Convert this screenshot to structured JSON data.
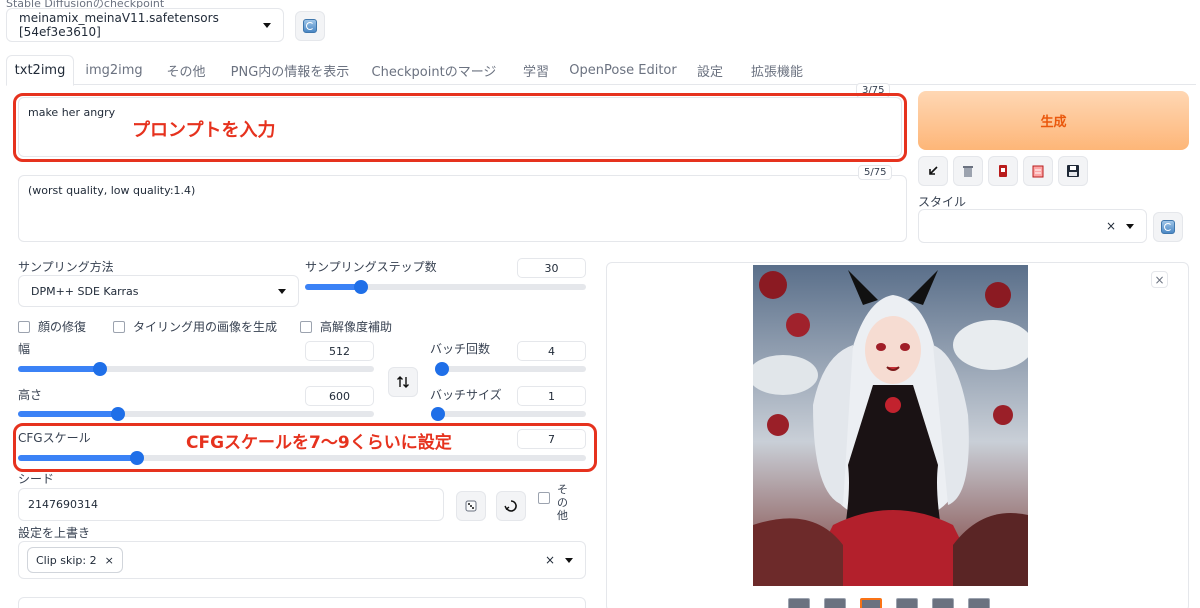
{
  "top_cut_label": "Stable Diffusionのcheckpoint",
  "checkpoint": {
    "value": "meinamix_meinaV11.safetensors [54ef3e3610]"
  },
  "tabs": [
    {
      "label": "txt2img"
    },
    {
      "label": "img2img"
    },
    {
      "label": "その他"
    },
    {
      "label": "PNG内の情報を表示"
    },
    {
      "label": "Checkpointのマージ"
    },
    {
      "label": "学習"
    },
    {
      "label": "OpenPose Editor"
    },
    {
      "label": "設定"
    },
    {
      "label": "拡張機能"
    }
  ],
  "prompt": {
    "value": "make her angry",
    "counter": "3/75"
  },
  "negative_prompt": {
    "value": "(worst quality, low quality:1.4)",
    "counter": "5/75"
  },
  "annotations": {
    "prompt": "プロンプトを入力",
    "cfg": "CFGスケールを7〜9くらいに設定"
  },
  "generate_label": "生成",
  "style": {
    "label": "スタイル"
  },
  "sampling": {
    "method_label": "サンプリング方法",
    "method_value": "DPM++ SDE Karras",
    "steps_label": "サンプリングステップ数",
    "steps_value": "30",
    "steps_fraction": 0.2
  },
  "checks": {
    "face": "顔の修復",
    "tiling": "タイリング用の画像を生成",
    "hires": "高解像度補助"
  },
  "width": {
    "label": "幅",
    "value": "512",
    "fraction": 0.23
  },
  "height": {
    "label": "高さ",
    "value": "600",
    "fraction": 0.28
  },
  "batch_count": {
    "label": "バッチ回数",
    "value": "4",
    "fraction": 0.03
  },
  "batch_size": {
    "label": "バッチサイズ",
    "value": "1",
    "fraction": 0.0
  },
  "cfg": {
    "label": "CFGスケール",
    "value": "7",
    "fraction": 0.21
  },
  "seed": {
    "label": "シード",
    "value": "2147690314",
    "other_label": "その他"
  },
  "override": {
    "label": "設定を上書き",
    "chip": "Clip skip: 2"
  },
  "colors": {
    "accent": "#3b82f6",
    "annotation": "#e6321e",
    "generate": "#fdb678"
  }
}
